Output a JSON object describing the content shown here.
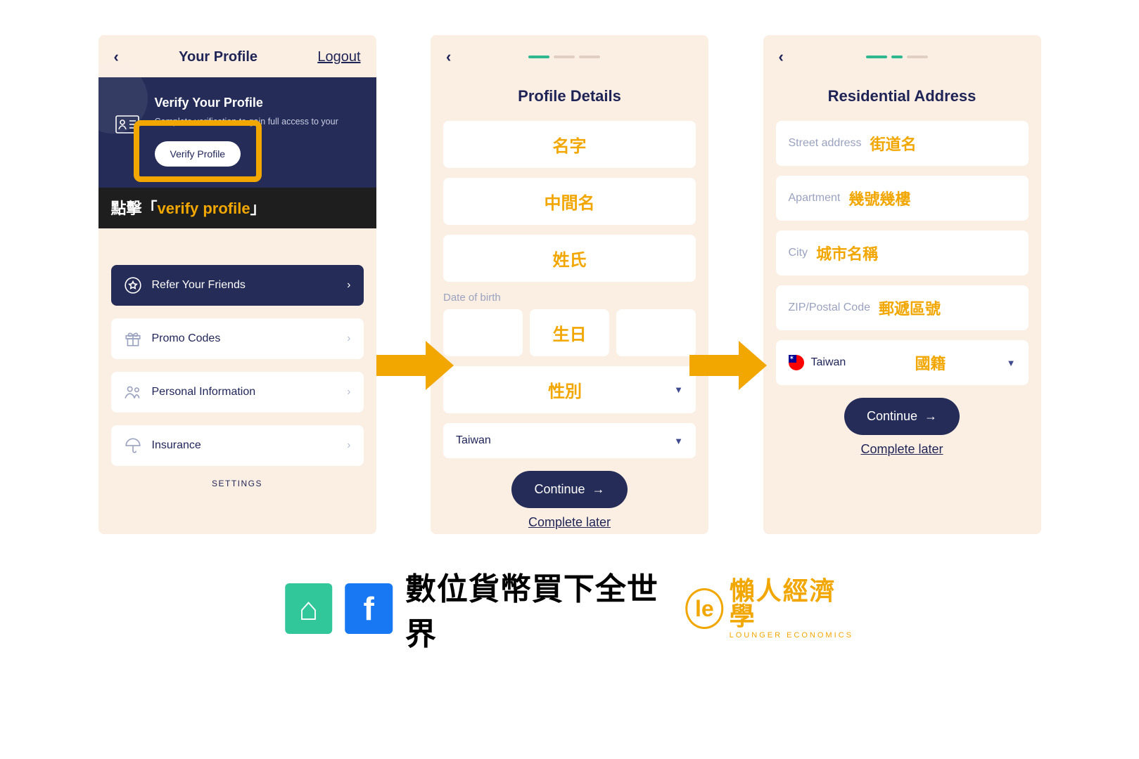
{
  "screen1": {
    "title": "Your Profile",
    "logout": "Logout",
    "verify_title": "Verify Your Profile",
    "verify_desc": "Complete verification to gain full access to your",
    "verify_btn": "Verify Profile",
    "callout_pre": "點擊「",
    "callout_hl": "verify profile",
    "callout_post": "」",
    "rows": {
      "refer": "Refer Your Friends",
      "promo": "Promo Codes",
      "personal": "Personal Information",
      "insurance": "Insurance"
    },
    "settings": "SETTINGS"
  },
  "screen2": {
    "title": "Profile Details",
    "dob_label": "Date of birth",
    "fields": {
      "first": "名字",
      "middle": "中間名",
      "last": "姓氏",
      "dob": "生日",
      "gender": "性別"
    },
    "country": "Taiwan",
    "continue": "Continue",
    "later": "Complete later"
  },
  "screen3": {
    "title": "Residential Address",
    "fields": {
      "street_ph": "Street address",
      "street_ov": "街道名",
      "apt_ph": "Apartment",
      "apt_ov": "幾號幾樓",
      "city_ph": "City",
      "city_ov": "城市名稱",
      "zip_ph": "ZIP/Postal Code",
      "zip_ov": "郵遞區號",
      "country_val": "Taiwan",
      "country_ov": "國籍"
    },
    "continue": "Continue",
    "later": "Complete later"
  },
  "footer": {
    "main": "數位貨幣買下全世界",
    "lounger_cn": "懶人經濟學",
    "lounger_en": "LOUNGER ECONOMICS"
  }
}
